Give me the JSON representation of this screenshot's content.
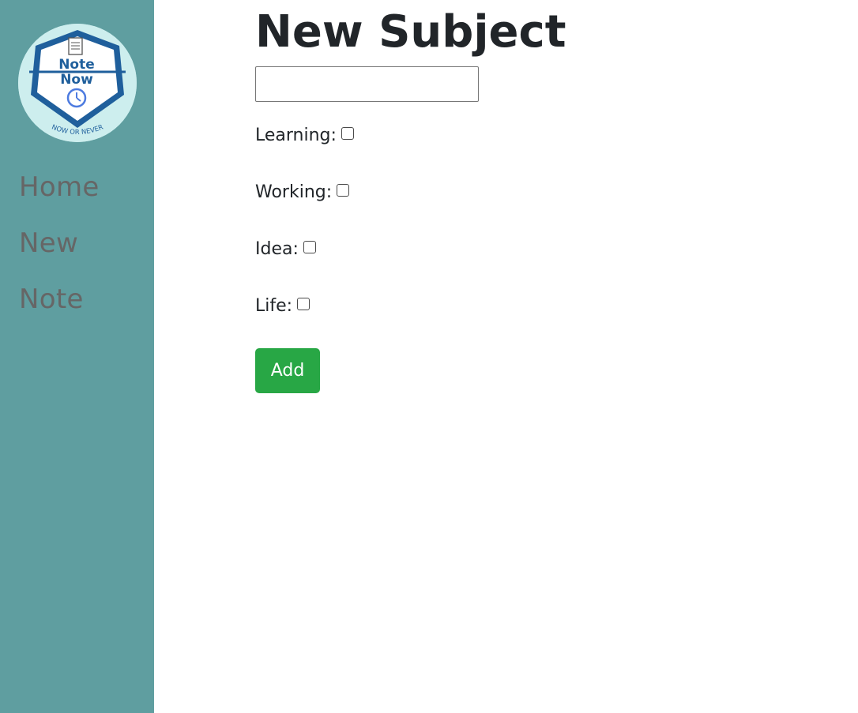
{
  "sidebar": {
    "logo": {
      "title_line1": "Note",
      "title_line2": "Now",
      "tagline": "NOW OR NEVER",
      "icon": "clock-icon"
    },
    "nav": [
      {
        "label": "Home"
      },
      {
        "label": "New"
      },
      {
        "label": "Note"
      }
    ]
  },
  "main": {
    "title": "New Subject",
    "subject_input": {
      "value": "",
      "placeholder": ""
    },
    "categories": [
      {
        "label": "Learning:",
        "checked": false
      },
      {
        "label": "Working:",
        "checked": false
      },
      {
        "label": "Idea:",
        "checked": false
      },
      {
        "label": "Life:",
        "checked": false
      }
    ],
    "add_label": "Add"
  },
  "colors": {
    "sidebar_bg": "#5f9ea0",
    "nav_text": "#666666",
    "add_button": "#28a745",
    "logo_blue": "#1f5f9c"
  }
}
